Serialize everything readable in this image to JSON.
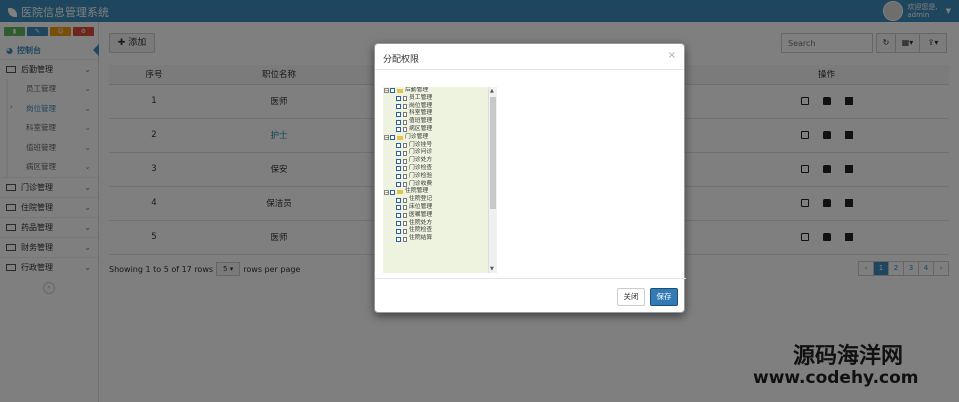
{
  "header": {
    "app_title": "医院信息管理系统",
    "user_line1": "欢迎您是,",
    "user_line2": "admin"
  },
  "sidebar": {
    "colors": [
      "#5cb85c",
      "#3c8dbc",
      "#f39c12",
      "#dd4b39"
    ],
    "dashboard": "控制台",
    "sections": [
      {
        "label": "后勤管理",
        "open": true
      },
      {
        "label": "门诊管理"
      },
      {
        "label": "住院管理"
      },
      {
        "label": "药品管理"
      },
      {
        "label": "财务管理"
      },
      {
        "label": "行政管理"
      }
    ],
    "sub_items": [
      "员工管理",
      "岗位管理",
      "科室管理",
      "值班管理",
      "病区管理"
    ]
  },
  "toolbar": {
    "add_label": "添加",
    "search_placeholder": "Search"
  },
  "table": {
    "columns": [
      "序号",
      "职位名称",
      "操作"
    ],
    "rows": [
      {
        "index": "1",
        "name": "医师"
      },
      {
        "index": "2",
        "name": "护士"
      },
      {
        "index": "3",
        "name": "保安"
      },
      {
        "index": "4",
        "name": "保洁员"
      },
      {
        "index": "5",
        "name": "医师"
      }
    ]
  },
  "pager": {
    "showing_text": "Showing 1 to 5 of 17 rows",
    "page_size": "5",
    "rows_per_page_text": "rows per page",
    "pages": [
      "‹",
      "1",
      "2",
      "3",
      "4",
      "›"
    ],
    "active_page": "1"
  },
  "modal": {
    "title": "分配权限",
    "close_label": "关闭",
    "save_label": "保存",
    "tree": [
      {
        "label": "后勤管理",
        "type": "parent"
      },
      {
        "label": "员工管理",
        "type": "child"
      },
      {
        "label": "岗位管理",
        "type": "child"
      },
      {
        "label": "科室管理",
        "type": "child"
      },
      {
        "label": "值班管理",
        "type": "child"
      },
      {
        "label": "病区管理",
        "type": "child"
      },
      {
        "label": "门诊管理",
        "type": "parent"
      },
      {
        "label": "门诊挂号",
        "type": "child"
      },
      {
        "label": "门诊问诊",
        "type": "child"
      },
      {
        "label": "门诊处方",
        "type": "child"
      },
      {
        "label": "门诊检查",
        "type": "child"
      },
      {
        "label": "门诊检验",
        "type": "child"
      },
      {
        "label": "门诊收费",
        "type": "child"
      },
      {
        "label": "住院管理",
        "type": "parent"
      },
      {
        "label": "住院登记",
        "type": "child"
      },
      {
        "label": "床位管理",
        "type": "child"
      },
      {
        "label": "医嘱管理",
        "type": "child"
      },
      {
        "label": "住院处方",
        "type": "child"
      },
      {
        "label": "住院检查",
        "type": "child"
      },
      {
        "label": "住院结算",
        "type": "child"
      }
    ]
  },
  "watermark": {
    "line1": "源码海洋网",
    "line2": "www.codehy.com"
  }
}
